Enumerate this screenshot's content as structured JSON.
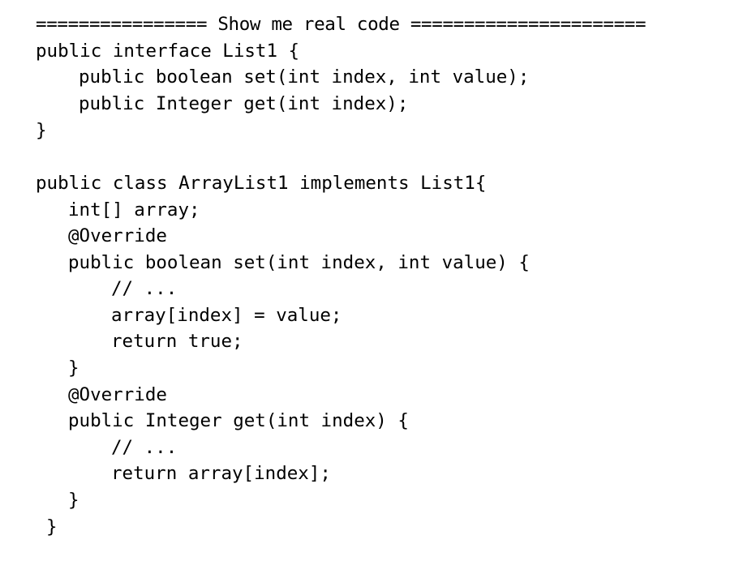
{
  "code": {
    "lines": [
      "================ Show me real code ======================",
      "public interface List1 {",
      "public boolean set(int index, int value);",
      "public Integer get(int index);",
      "}",
      "public class ArrayList1 implements List1{",
      "int[] array;",
      "@Override",
      "public boolean set(int index, int value) {",
      "// ...",
      "array[index] = value;",
      "return true;",
      "}",
      "@Override",
      "public Integer get(int index) {",
      "// ...",
      "return array[index];",
      "}",
      "}"
    ]
  }
}
